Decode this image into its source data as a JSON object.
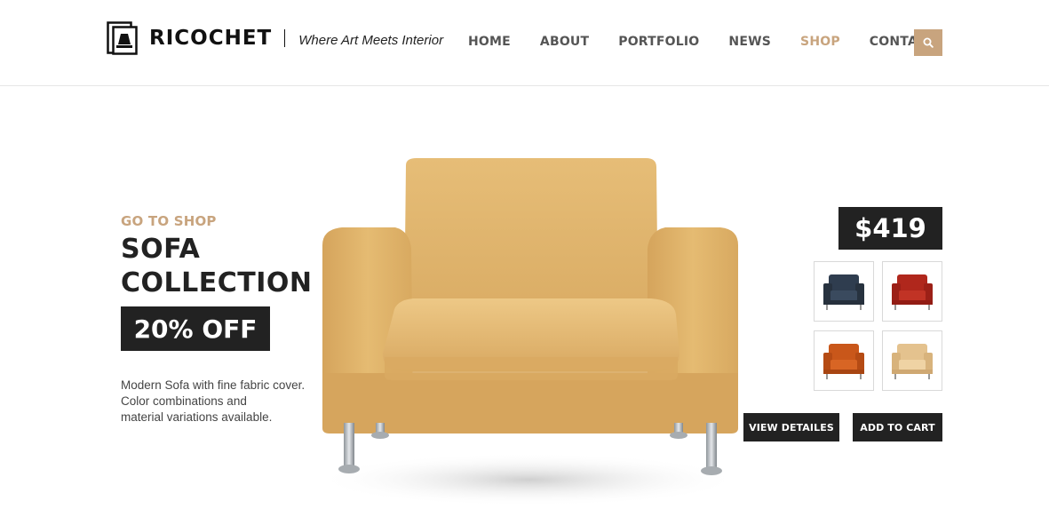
{
  "header": {
    "brand": "RICOCHET",
    "tagline": "Where Art Meets Interior",
    "nav": [
      {
        "label": "HOME",
        "active": false
      },
      {
        "label": "ABOUT",
        "active": false
      },
      {
        "label": "PORTFOLIO",
        "active": false
      },
      {
        "label": "NEWS",
        "active": false
      },
      {
        "label": "SHOP",
        "active": true
      },
      {
        "label": "CONTACT",
        "active": false
      }
    ],
    "search_icon": "search-icon"
  },
  "hero": {
    "kicker": "GO TO SHOP",
    "title_line1": "SOFA",
    "title_line2": "COLLECTION",
    "discount": "20% OFF",
    "description_line1": "Modern Sofa with fine fabric cover.",
    "description_line2": "Color combinations and",
    "description_line3": "material variations available."
  },
  "product": {
    "price": "$419",
    "swatches": [
      {
        "name": "navy",
        "color": "#2f3d4f"
      },
      {
        "name": "red",
        "color": "#b0271c"
      },
      {
        "name": "orange",
        "color": "#c9571a"
      },
      {
        "name": "beige",
        "color": "#e4c28e"
      }
    ],
    "view_details_label": "VIEW DETAILES",
    "add_to_cart_label": "ADD TO CART"
  },
  "colors": {
    "accent": "#c8a47e",
    "dark": "#222222",
    "sofa": "#e0b66f"
  }
}
